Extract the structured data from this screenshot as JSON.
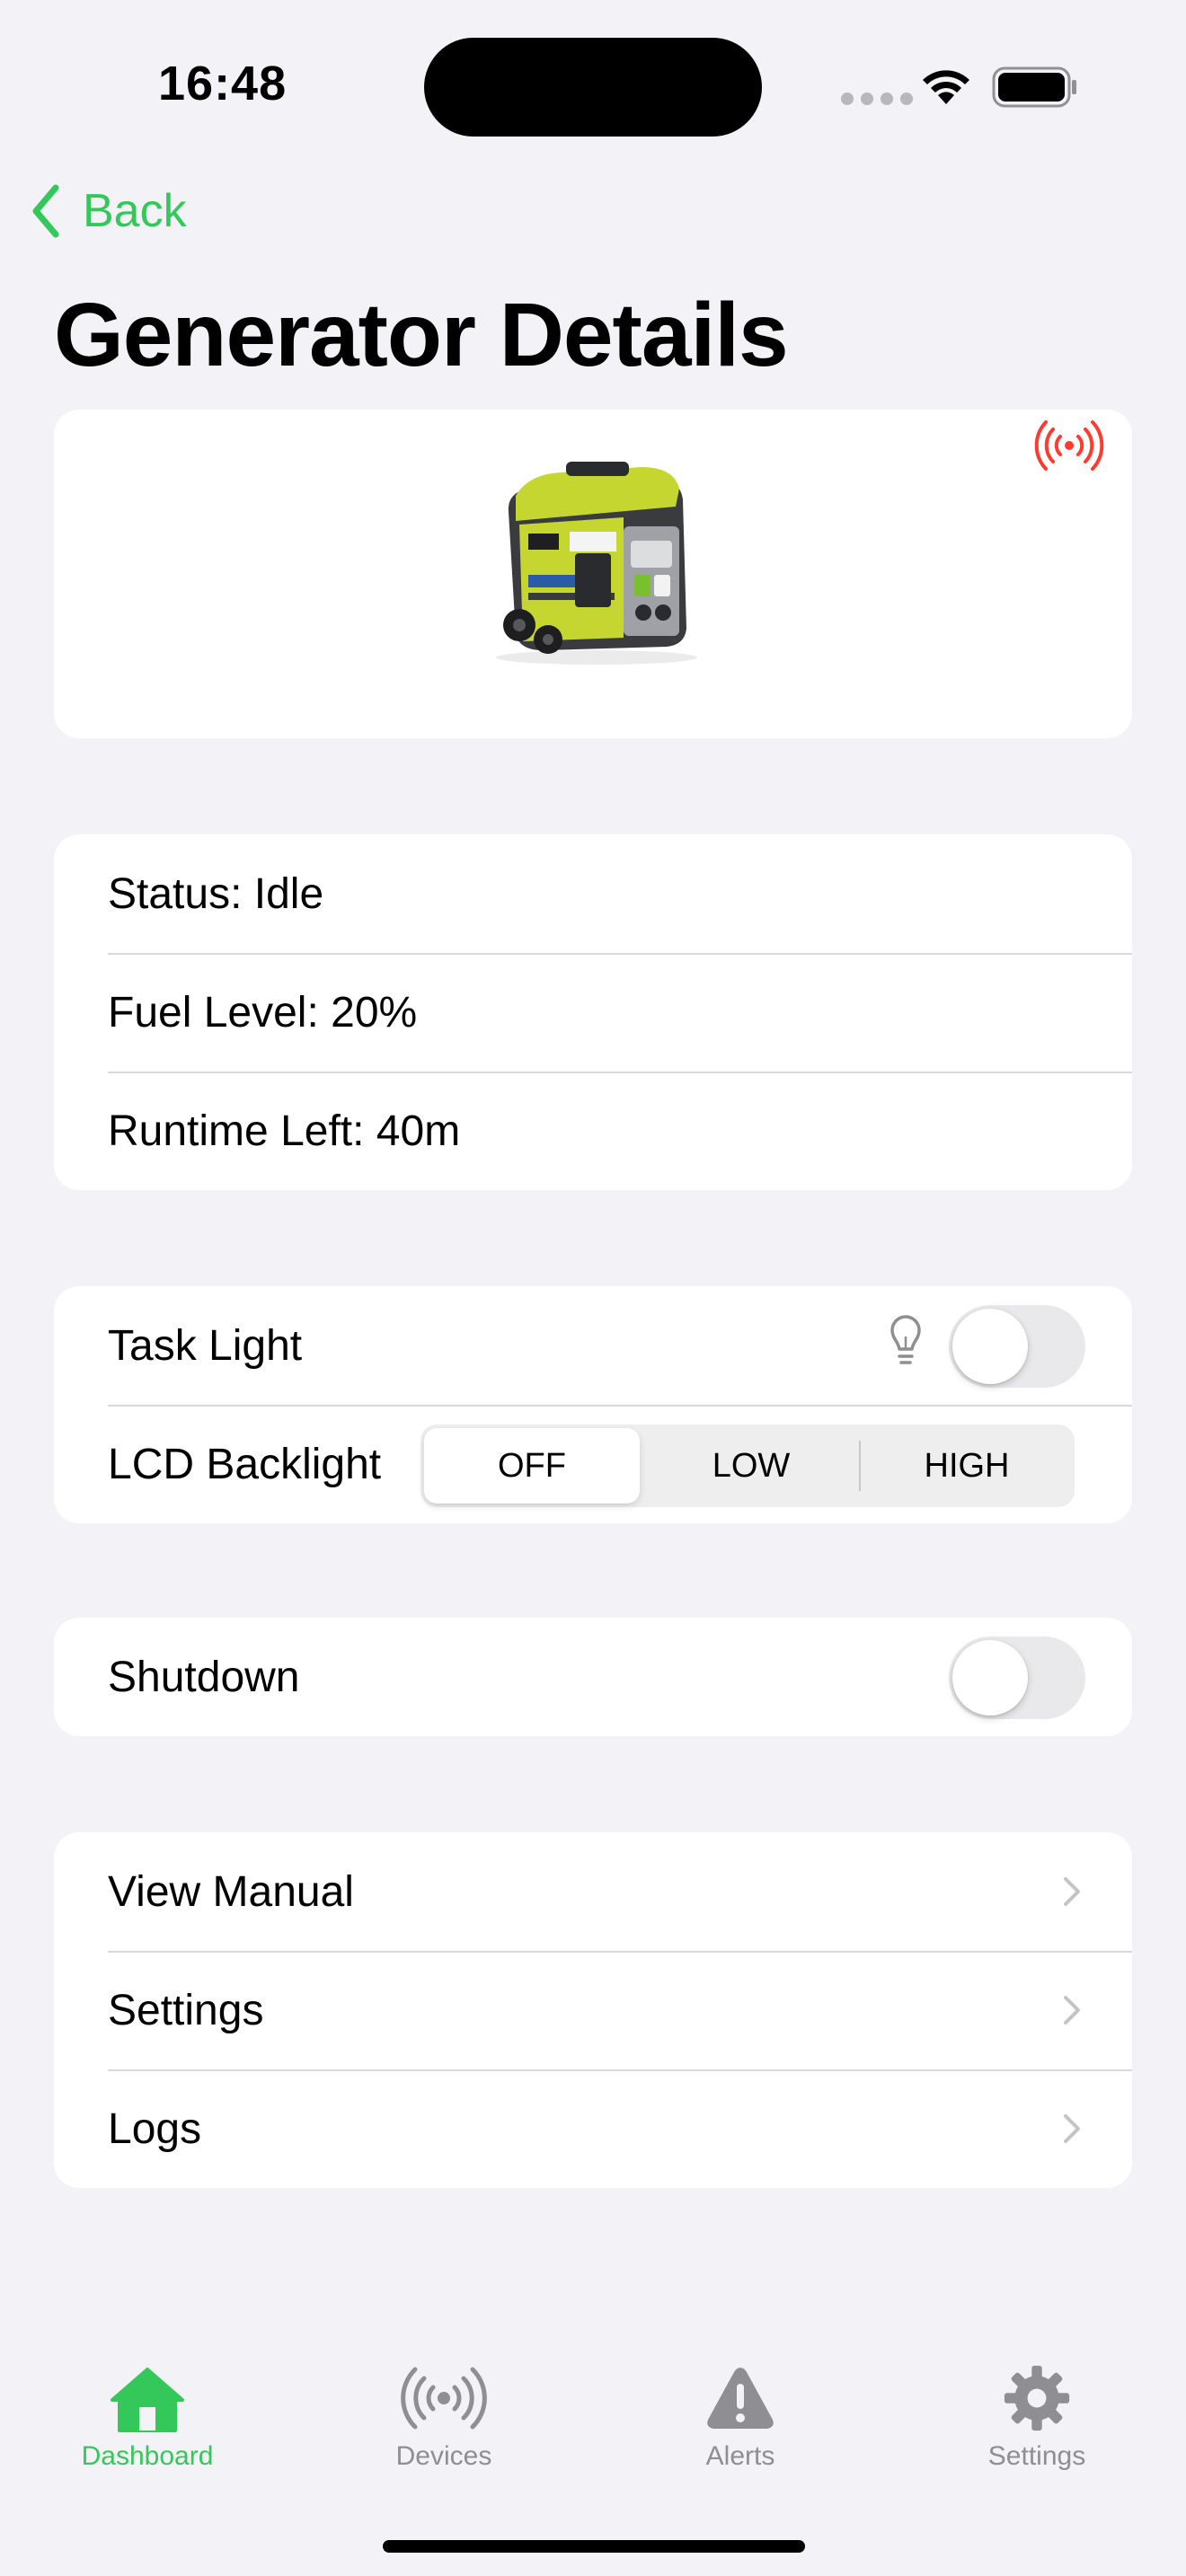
{
  "status_bar": {
    "time": "16:48"
  },
  "nav": {
    "back_label": "Back",
    "title": "Generator Details"
  },
  "colors": {
    "accent": "#34C759",
    "live_indicator": "#FF3B30",
    "inactive": "#8E8E93"
  },
  "info": {
    "status": "Status: Idle",
    "fuel": "Fuel Level: 20%",
    "runtime": "Runtime Left: 40m"
  },
  "controls": {
    "task_light_label": "Task Light",
    "task_light_on": false,
    "backlight_label": "LCD Backlight",
    "backlight_options": [
      "OFF",
      "LOW",
      "HIGH"
    ],
    "backlight_selected": "OFF"
  },
  "shutdown": {
    "label": "Shutdown",
    "on": false
  },
  "links": [
    {
      "label": "View Manual"
    },
    {
      "label": "Settings"
    },
    {
      "label": "Logs"
    }
  ],
  "tabs": [
    {
      "label": "Dashboard",
      "icon": "house-icon",
      "active": true
    },
    {
      "label": "Devices",
      "icon": "broadcast-icon",
      "active": false
    },
    {
      "label": "Alerts",
      "icon": "warning-icon",
      "active": false
    },
    {
      "label": "Settings",
      "icon": "gear-icon",
      "active": false
    }
  ]
}
